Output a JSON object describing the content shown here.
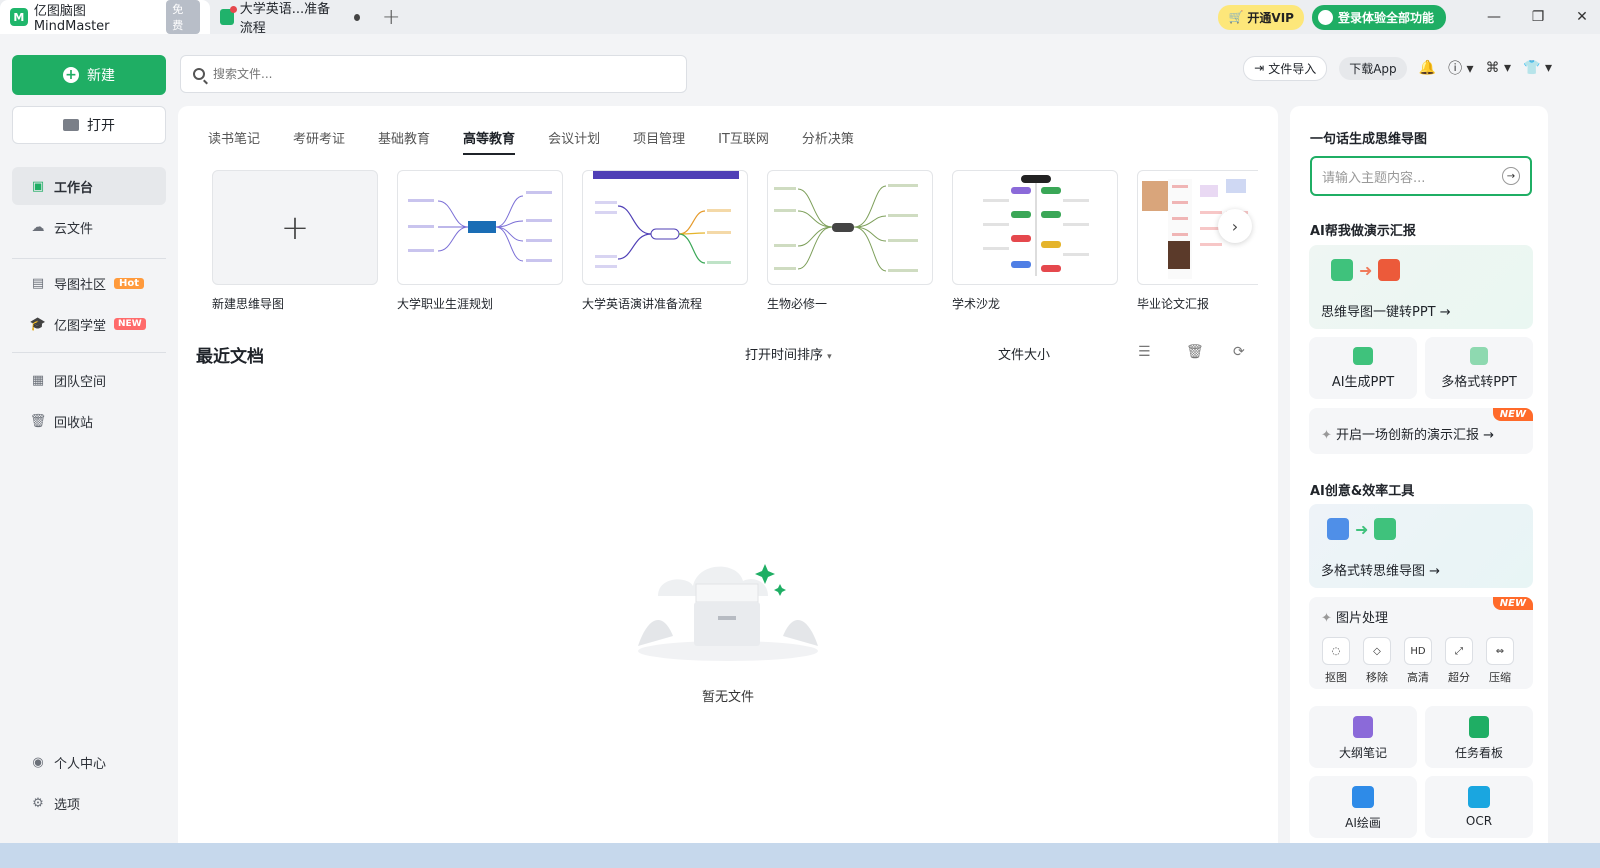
{
  "titlebar": {
    "app_tab_label": "亿图脑图MindMaster",
    "free_badge": "免费",
    "doc_tab_label": "大学英语...准备流程",
    "vip_button": "开通VIP",
    "login_button": "登录体验全部功能"
  },
  "sidebar": {
    "new_label": "新建",
    "open_label": "打开",
    "items": [
      {
        "label": "工作台"
      },
      {
        "label": "云文件"
      },
      {
        "label": "导图社区",
        "badge": "Hot"
      },
      {
        "label": "亿图学堂",
        "badge": "NEW"
      },
      {
        "label": "团队空间"
      },
      {
        "label": "回收站"
      },
      {
        "label": "个人中心"
      },
      {
        "label": "选项"
      }
    ]
  },
  "search": {
    "placeholder": "搜索文件..."
  },
  "top_actions": {
    "import_label": "文件导入",
    "download_app": "下载App"
  },
  "categories": [
    "读书笔记",
    "考研考证",
    "基础教育",
    "高等教育",
    "会议计划",
    "项目管理",
    "IT互联网",
    "分析决策"
  ],
  "templates": [
    {
      "label": "新建思维导图"
    },
    {
      "label": "大学职业生涯规划"
    },
    {
      "label": "大学英语演讲准备流程"
    },
    {
      "label": "生物必修一"
    },
    {
      "label": "学术沙龙"
    },
    {
      "label": "毕业论文汇报"
    }
  ],
  "recent": {
    "title": "最近文档",
    "sort_label": "打开时间排序",
    "size_label": "文件大小",
    "empty_text": "暂无文件"
  },
  "right_panel": {
    "gen_title": "一句话生成思维导图",
    "gen_placeholder": "请输入主题内容...",
    "ai_present_title": "AI帮我做演示汇报",
    "mind_to_ppt": "思维导图一键转PPT →",
    "ai_ppt": "AI生成PPT",
    "multi_ppt": "多格式转PPT",
    "new_flag": "NEW",
    "start_present": "开启一场创新的演示汇报 →",
    "ai_tools_title": "AI创意&效率工具",
    "multi_to_mind": "多格式转思维导图 →",
    "image_process": "图片处理",
    "image_tools": [
      "抠图",
      "移除",
      "高清",
      "超分",
      "压缩"
    ],
    "outline_note": "大纲笔记",
    "task_board": "任务看板",
    "ai_drawing": "AI绘画",
    "ocr": "OCR"
  },
  "colors": {
    "brand": "#1fae64",
    "vip": "#fde77a",
    "hot": "#ff9a3c",
    "new": "#ff6a2a"
  }
}
